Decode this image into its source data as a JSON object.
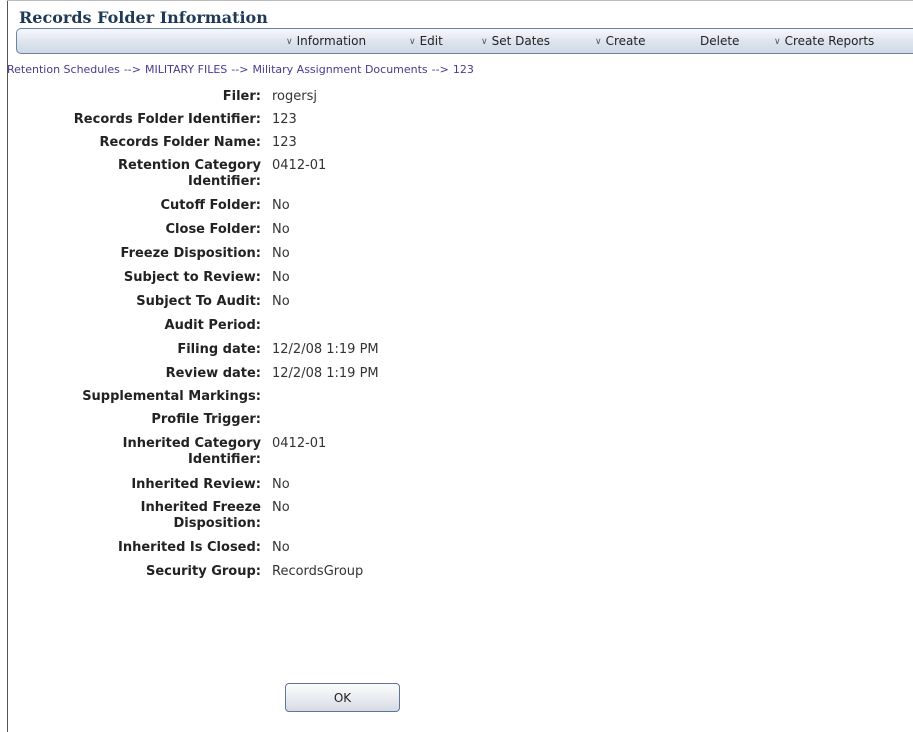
{
  "title": "Records Folder Information",
  "toolbar": {
    "items": [
      {
        "label": "Information",
        "has_dropdown": true
      },
      {
        "label": "Edit",
        "has_dropdown": true
      },
      {
        "label": "Set Dates",
        "has_dropdown": true
      },
      {
        "label": "Create",
        "has_dropdown": true
      },
      {
        "label": "Delete",
        "has_dropdown": false
      },
      {
        "label": "Create Reports",
        "has_dropdown": true
      }
    ]
  },
  "breadcrumb": {
    "items": [
      "Retention Schedules",
      "MILITARY FILES",
      "Military Assignment Documents",
      "123"
    ],
    "separator": "-->"
  },
  "fields": [
    {
      "label": "Filer:",
      "value": "rogersj"
    },
    {
      "label": "Records Folder Identifier:",
      "value": "123"
    },
    {
      "label": "Records Folder Name:",
      "value": "123"
    },
    {
      "label": "Retention Category Identifier:",
      "value": "0412-01"
    },
    {
      "label": "Cutoff Folder:",
      "value": "No"
    },
    {
      "label": "Close Folder:",
      "value": "No"
    },
    {
      "label": "Freeze Disposition:",
      "value": "No"
    },
    {
      "label": "Subject to Review:",
      "value": "No"
    },
    {
      "label": "Subject To Audit:",
      "value": "No"
    },
    {
      "label": "Audit Period:",
      "value": ""
    },
    {
      "label": "Filing date:",
      "value": "12/2/08 1:19 PM"
    },
    {
      "label": "Review date:",
      "value": "12/2/08 1:19 PM"
    },
    {
      "label": "Supplemental Markings:",
      "value": ""
    },
    {
      "label": "Profile Trigger:",
      "value": ""
    },
    {
      "label": "Inherited Category Identifier:",
      "value": "0412-01"
    },
    {
      "label": "Inherited Review:",
      "value": "No"
    },
    {
      "label": "Inherited Freeze Disposition:",
      "value": "No"
    },
    {
      "label": "Inherited Is Closed:",
      "value": "No"
    },
    {
      "label": "Security Group:",
      "value": "RecordsGroup"
    }
  ],
  "ok_label": "OK",
  "colors": {
    "title": "#1f3a56",
    "breadcrumb": "#4b3a8c",
    "toolbar_border": "#6d84a8"
  }
}
